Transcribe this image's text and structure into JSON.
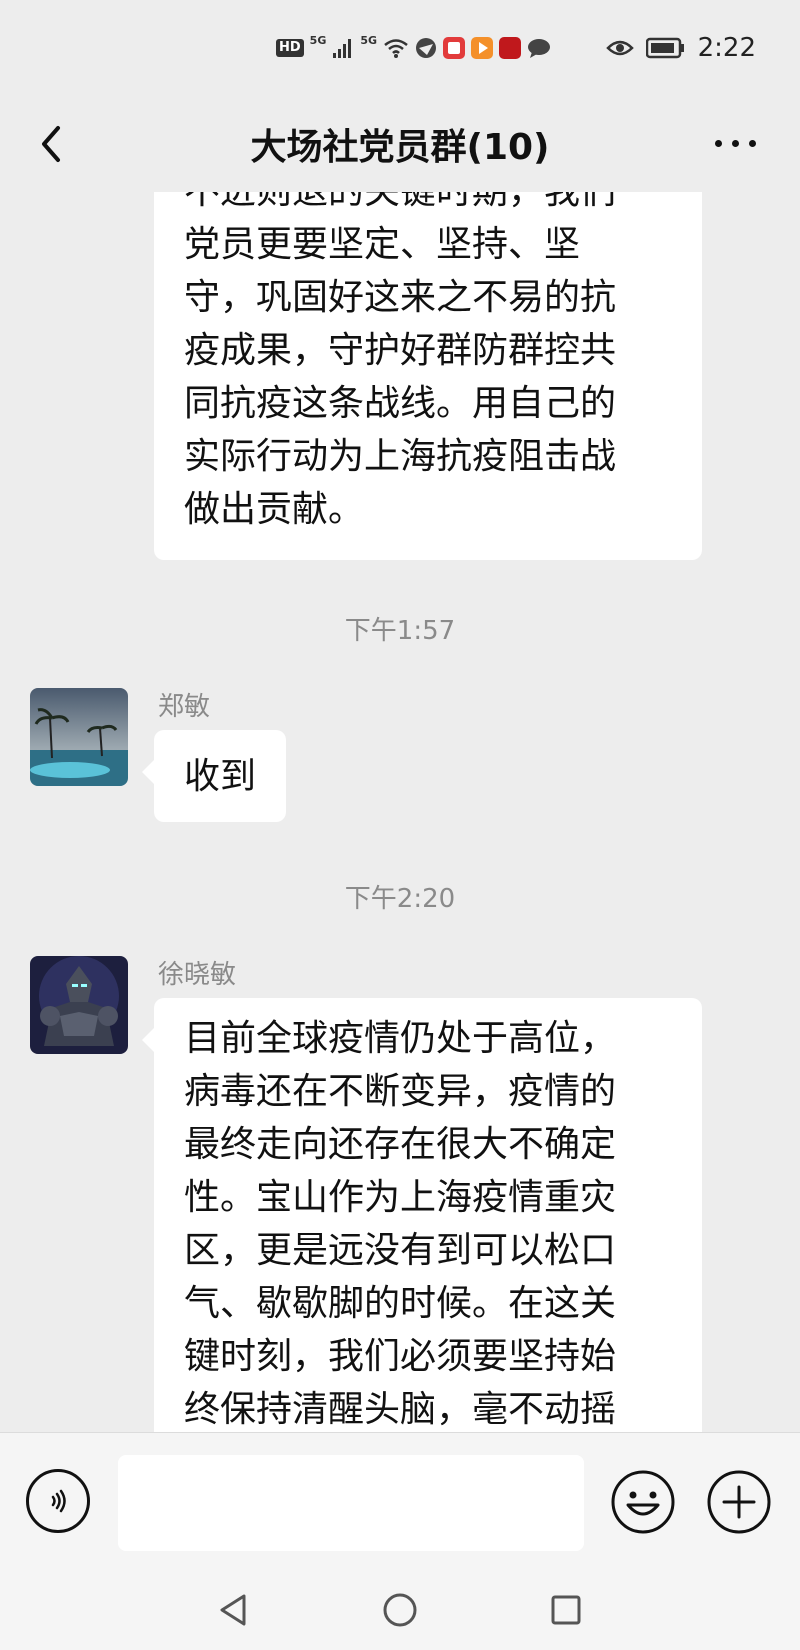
{
  "status_bar": {
    "hd": "HD",
    "network_1": "5G",
    "network_2": "5G",
    "time": "2:22",
    "icons": [
      "hd-icon",
      "signal-icon",
      "signal-icon",
      "wifi-icon",
      "browser-icon",
      "reader-app-icon",
      "video-app-icon",
      "study-app-icon",
      "chat-bubble-icon",
      "eye-icon",
      "battery-icon"
    ]
  },
  "header": {
    "title": "大场社党员群(10)",
    "back_icon": "chevron-left-icon",
    "more_icon": "more-dots-icon"
  },
  "messages": {
    "first": {
      "lines": [
        "不进则退的关键时期，我们",
        "党员更要坚定、坚持、坚",
        "守，巩固好这来之不易的抗",
        "疫成果，守护好群防群控共",
        "同抗疫这条战线。用自己的",
        "实际行动为上海抗疫阻击战",
        "做出贡献。"
      ]
    },
    "time_1": "下午1:57",
    "second": {
      "sender": "郑敏",
      "text": "收到"
    },
    "time_2": "下午2:20",
    "third": {
      "sender": "徐晓敏",
      "lines": [
        "目前全球疫情仍处于高位，",
        "病毒还在不断变异，疫情的",
        "最终走向还存在很大不确定",
        "性。宝山作为上海疫情重灾",
        "区，更是远没有到可以松口",
        "气、歇歇脚的时候。在这关",
        "键时刻，我们必须要坚持始",
        "终保持清醒头脑，毫不动摇"
      ]
    }
  },
  "input_bar": {
    "voice_icon": "voice-icon",
    "placeholder": "",
    "emoji_icon": "emoji-icon",
    "plus_icon": "plus-icon"
  },
  "system_nav": {
    "back": "triangle-back-icon",
    "home": "circle-home-icon",
    "recents": "square-recents-icon"
  }
}
